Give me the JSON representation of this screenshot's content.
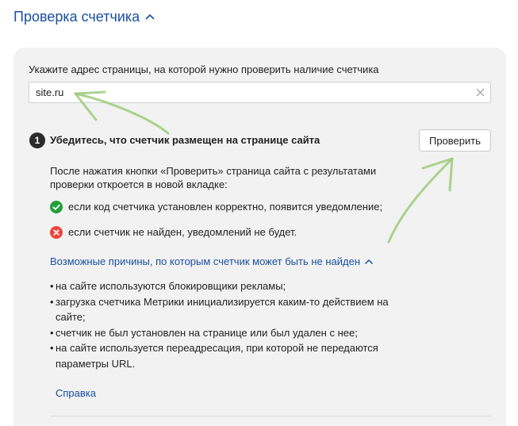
{
  "section": {
    "title": "Проверка счетчика"
  },
  "form": {
    "label": "Укажите адрес страницы, на которой нужно проверить наличие счетчика",
    "url_value": "site.ru"
  },
  "step": {
    "number": "1",
    "title": "Убедитесь, что счетчик размещен на странице сайта",
    "button_label": "Проверить",
    "description": "После нажатия кнопки «Проверить» страница сайта с результатами проверки откроется в новой вкладке:",
    "status_ok": "если код счетчика установлен корректно, появится уведомление;",
    "status_fail": "если счетчик не найден, уведомлений не будет."
  },
  "reasons": {
    "toggle_label": "Возможные причины, по которым счетчик может быть не найден",
    "items": [
      "на сайте используются блокировщики рекламы;",
      "загрузка счетчика Метрики инициализируется каким-то действием на сайте;",
      "счетчик не был установлен на странице или был удален с нее;",
      "на сайте используется переадресация, при которой не передаются параметры URL."
    ]
  },
  "help": {
    "link_label": "Справка"
  },
  "colors": {
    "link": "#1a4fa0",
    "card_bg": "#f2f2f2",
    "ok": "#21a038",
    "error": "#f0433d",
    "annotation_arrow": "#9ccc7a"
  },
  "icons": {
    "header_chevron": "chevron-up-icon",
    "clear": "close-icon",
    "ok": "check-circle-icon",
    "fail": "cross-circle-icon",
    "reasons_chevron": "chevron-up-icon"
  }
}
